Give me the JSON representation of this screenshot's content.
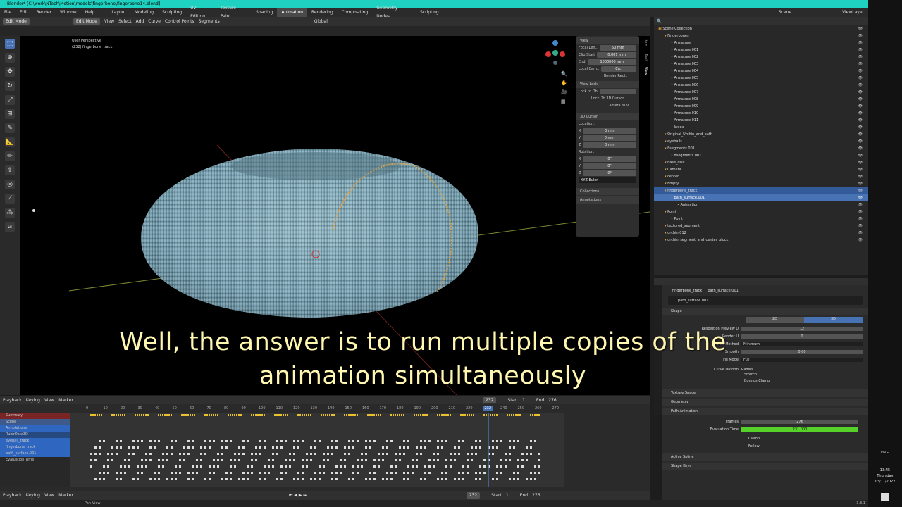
{
  "title": "Blender* [C:\\work\\NTech\\Motion\\models\\fingerbone\\fingerbone14.blend]",
  "menus": [
    "File",
    "Edit",
    "Render",
    "Window",
    "Help"
  ],
  "workspaces": [
    "Layout",
    "Modeling",
    "Sculpting",
    "UV Editing",
    "Texture Paint",
    "Shading",
    "Animation",
    "Rendering",
    "Compositing",
    "Geometry Nodes",
    "Scripting"
  ],
  "scene": {
    "label": "Scene",
    "viewlayer": "ViewLayer"
  },
  "viewport_header": {
    "mode": "Edit Mode",
    "items": [
      "View",
      "Select",
      "Add",
      "Curve",
      "Control Points",
      "Segments"
    ],
    "orientation": "Global"
  },
  "viewport_info": {
    "perspective": "User Perspective",
    "object": "(232) fingerbone_track"
  },
  "npanel": {
    "view_title": "View",
    "focal_label": "Focal Len..",
    "focal_value": "50 mm",
    "clip_start_label": "Clip Start",
    "clip_start_value": "0.001 mm",
    "end_label": "End",
    "end_value": "1000000 mm",
    "local_cam_label": "Local Cam..",
    "local_cam_value": "Ca..",
    "render_region": "Render Regi..",
    "view_lock": "View Lock",
    "lock_to_ob": "Lock to Ob",
    "lock": "Lock",
    "to_3d_cursor": "To 3D Cursor",
    "camera_to_view": "Camera to V..",
    "cursor_title": "3D Cursor",
    "location": "Location:",
    "x": "X",
    "y": "Y",
    "z": "Z",
    "loc_x": "0 mm",
    "loc_y": "0 mm",
    "loc_z": "0 mm",
    "rotation": "Rotation:",
    "rot_x": "0°",
    "rot_y": "0°",
    "rot_z": "0°",
    "euler": "XYZ Euler",
    "collections": "Collections",
    "annotations": "Annotations",
    "tabs": [
      "Item",
      "Tool",
      "View"
    ]
  },
  "outliner": {
    "rows": [
      {
        "indent": 0,
        "text": "Scene Collection"
      },
      {
        "indent": 1,
        "text": "Fingerbones"
      },
      {
        "indent": 2,
        "text": "Armature"
      },
      {
        "indent": 2,
        "text": "Armature.001"
      },
      {
        "indent": 2,
        "text": "Armature.002"
      },
      {
        "indent": 2,
        "text": "Armature.003"
      },
      {
        "indent": 2,
        "text": "Armature.004"
      },
      {
        "indent": 2,
        "text": "Armature.005"
      },
      {
        "indent": 2,
        "text": "Armature.006"
      },
      {
        "indent": 2,
        "text": "Armature.007"
      },
      {
        "indent": 2,
        "text": "Armature.008"
      },
      {
        "indent": 2,
        "text": "Armature.009"
      },
      {
        "indent": 2,
        "text": "Armature.010"
      },
      {
        "indent": 2,
        "text": "Armature.011"
      },
      {
        "indent": 2,
        "text": "Index"
      },
      {
        "indent": 1,
        "text": "Original_Urchin_and_path"
      },
      {
        "indent": 1,
        "text": "eyeballs"
      },
      {
        "indent": 1,
        "text": "8segments.001"
      },
      {
        "indent": 2,
        "text": "8segments.001"
      },
      {
        "indent": 1,
        "text": "base_disc"
      },
      {
        "indent": 1,
        "text": "Camera"
      },
      {
        "indent": 1,
        "text": "center"
      },
      {
        "indent": 1,
        "text": "Empty"
      },
      {
        "indent": 1,
        "text": "fingerbone_track",
        "state": "sel"
      },
      {
        "indent": 2,
        "text": "path_surface.001",
        "state": "hl"
      },
      {
        "indent": 3,
        "text": "Animation"
      },
      {
        "indent": 1,
        "text": "Point"
      },
      {
        "indent": 2,
        "text": "Point"
      },
      {
        "indent": 1,
        "text": "textured_segment"
      },
      {
        "indent": 1,
        "text": "urchin.012"
      },
      {
        "indent": 1,
        "text": "urchin_segment_and_center_block"
      }
    ]
  },
  "properties": {
    "breadcrumb_obj": "fingerbone_track",
    "breadcrumb_data": "path_surface.001",
    "datablock": "path_surface.001",
    "shape": "Shape",
    "mode_2d": "2D",
    "mode_3d": "3D",
    "resolution_u_label": "Resolution Preview U",
    "resolution_u": "12",
    "render_u_label": "Render U",
    "render_u": "0",
    "twist_label": "Twist Method",
    "twist": "Minimum",
    "smooth_label": "Smooth",
    "smooth": "0.00",
    "fill_label": "Fill Mode",
    "fill": "Full",
    "curve_deform": "Curve Deform",
    "radius": "Radius",
    "stretch": "Stretch",
    "bounds_clamp": "Bounds Clamp",
    "texture_space": "Texture Space",
    "geometry": "Geometry",
    "path_animation": "Path Animation",
    "frames_label": "Frames",
    "frames": "276",
    "eval_label": "Evaluation Time",
    "eval": "231.000",
    "clamp": "Clamp",
    "follow": "Follow",
    "active_spline": "Active Spline",
    "shape_keys": "Shape Keys"
  },
  "timeline": {
    "header": [
      "Playback",
      "Keying",
      "View",
      "Marker"
    ],
    "frame": "232",
    "start_label": "Start",
    "start": "1",
    "end_label": "End",
    "end": "276",
    "ticks": [
      "0",
      "10",
      "20",
      "30",
      "40",
      "50",
      "60",
      "70",
      "80",
      "90",
      "100",
      "110",
      "120",
      "130",
      "140",
      "150",
      "160",
      "170",
      "180",
      "190",
      "200",
      "210",
      "220",
      "232",
      "240",
      "250",
      "260",
      "270"
    ],
    "channels": [
      "Summary",
      "Scene",
      "Annotations",
      "RulerData3D",
      "eyeball_track",
      "fingerbone_track",
      "path_surface.001",
      "Evaluation Time"
    ]
  },
  "status": {
    "left": "Pan View",
    "version": "3.3.1"
  },
  "caption": [
    "Well, the answer is to run multiple copies of the",
    "animation simultaneously"
  ],
  "clock": {
    "time": "13:45",
    "day": "Thursday",
    "date": "03/11/2022",
    "lang": "ENG"
  },
  "colors": {
    "accent": "#4772b3",
    "timebar": "#1ed1c0",
    "eval": "#56d12a",
    "caption": "#fff7b0"
  }
}
